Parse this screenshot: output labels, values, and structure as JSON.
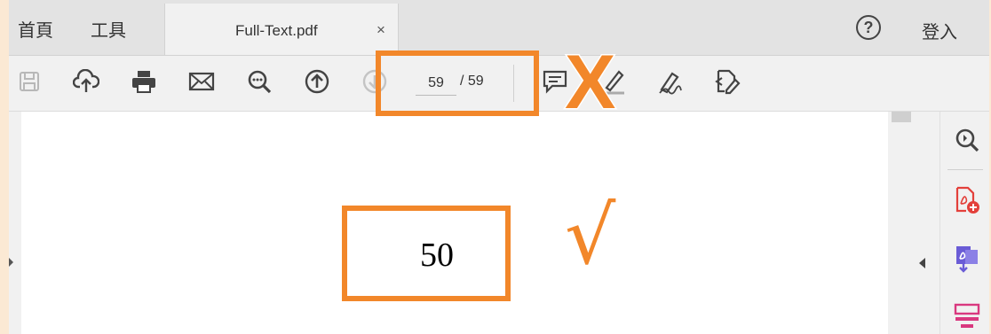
{
  "menu": {
    "home": "首頁",
    "tools": "工具"
  },
  "tab": {
    "filename": "Full-Text.pdf",
    "close": "×"
  },
  "header": {
    "help": "?",
    "login": "登入"
  },
  "toolbar": {
    "page_current": "59",
    "page_total": "/ 59",
    "icons": [
      "save-icon",
      "cloud-upload-icon",
      "print-icon",
      "email-icon",
      "zoom-search-icon",
      "page-up-icon",
      "page-down-icon",
      "comment-icon",
      "highlight-icon",
      "sign-icon",
      "edit-pdf-icon"
    ]
  },
  "document": {
    "page_number_text": "50"
  },
  "annotations": {
    "wrong_mark": "X",
    "right_mark": "√",
    "color": "#f2872a"
  },
  "right_panel": {
    "icons": [
      "zoom-panel-icon",
      "create-pdf-icon",
      "export-pdf-icon",
      "organize-icon"
    ]
  },
  "colors": {
    "accent": "#f2872a",
    "create_pdf": "#e3403b",
    "export_pdf": "#6a5cd6",
    "organize": "#d9387f"
  }
}
